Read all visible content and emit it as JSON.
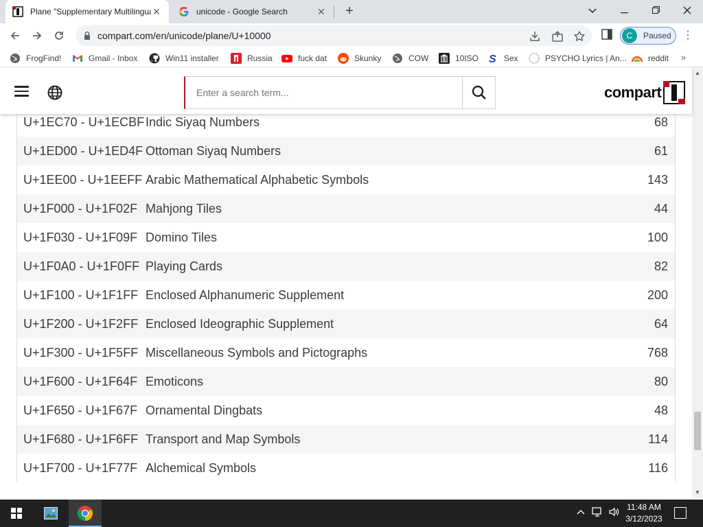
{
  "browser": {
    "tabs": [
      {
        "title": "Plane \"Supplementary Multilingual Plane\"",
        "close": "✕"
      },
      {
        "title": "unicode - Google Search",
        "close": "✕"
      }
    ],
    "new_tab": "+",
    "url": "compart.com/en/unicode/plane/U+10000",
    "profile_initial": "C",
    "profile_status": "Paused",
    "bookmarks": [
      {
        "label": "FrogFind!",
        "icon": "globe-icon",
        "color": "#5f6368"
      },
      {
        "label": "Gmail - Inbox",
        "icon": "gmail-icon",
        "color": "#ea4335"
      },
      {
        "label": "Win11 installer",
        "icon": "github-icon",
        "color": "#24292e"
      },
      {
        "label": "Russia",
        "icon": "russia-icon",
        "color": "#d71f26"
      },
      {
        "label": "fuck dat",
        "icon": "youtube-icon",
        "color": "#ff0000"
      },
      {
        "label": "Skunky",
        "icon": "reddit-icon",
        "color": "#ff4500"
      },
      {
        "label": "COW",
        "icon": "globe-icon",
        "color": "#5f6368"
      },
      {
        "label": "10ISO",
        "icon": "bank-icon",
        "color": "#222222"
      },
      {
        "label": "Sex",
        "icon": "s-icon",
        "color": "#1c3fa8"
      },
      {
        "label": "PSYCHO Lyrics | An...",
        "icon": "genius-icon",
        "color": "#9aa0a6"
      },
      {
        "label": "reddit",
        "icon": "rainbow-icon",
        "color": "#f4b400"
      }
    ],
    "bookmarks_more": "»"
  },
  "site": {
    "search_placeholder": "Enter a search term...",
    "logo_text": "compart",
    "accent": "#b2141c"
  },
  "blocks": [
    {
      "range": "U+1EC70 - U+1ECBF",
      "name": "Indic Siyaq Numbers",
      "count": "68"
    },
    {
      "range": "U+1ED00 - U+1ED4F",
      "name": "Ottoman Siyaq Numbers",
      "count": "61"
    },
    {
      "range": "U+1EE00 - U+1EEFF",
      "name": "Arabic Mathematical Alphabetic Symbols",
      "count": "143"
    },
    {
      "range": "U+1F000 - U+1F02F",
      "name": "Mahjong Tiles",
      "count": "44"
    },
    {
      "range": "U+1F030 - U+1F09F",
      "name": "Domino Tiles",
      "count": "100"
    },
    {
      "range": "U+1F0A0 - U+1F0FF",
      "name": "Playing Cards",
      "count": "82"
    },
    {
      "range": "U+1F100 - U+1F1FF",
      "name": "Enclosed Alphanumeric Supplement",
      "count": "200"
    },
    {
      "range": "U+1F200 - U+1F2FF",
      "name": "Enclosed Ideographic Supplement",
      "count": "64"
    },
    {
      "range": "U+1F300 - U+1F5FF",
      "name": "Miscellaneous Symbols and Pictographs",
      "count": "768"
    },
    {
      "range": "U+1F600 - U+1F64F",
      "name": "Emoticons",
      "count": "80"
    },
    {
      "range": "U+1F650 - U+1F67F",
      "name": "Ornamental Dingbats",
      "count": "48"
    },
    {
      "range": "U+1F680 - U+1F6FF",
      "name": "Transport and Map Symbols",
      "count": "114"
    },
    {
      "range": "U+1F700 - U+1F77F",
      "name": "Alchemical Symbols",
      "count": "116"
    }
  ],
  "taskbar": {
    "time": "11:48 AM",
    "date": "3/12/2023"
  }
}
